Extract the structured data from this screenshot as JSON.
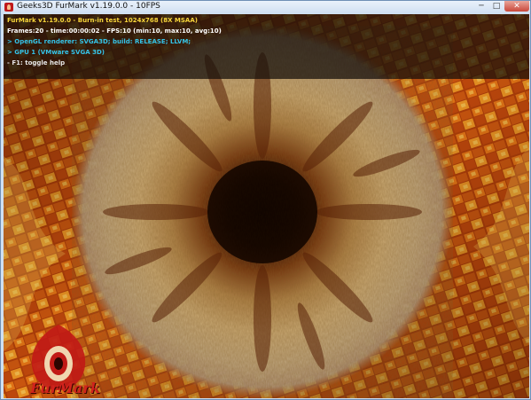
{
  "window": {
    "title": "Geeks3D FurMark v1.19.0.0 - 10FPS",
    "buttons": {
      "minimize": "─",
      "maximize": "□",
      "close": "✕"
    }
  },
  "hud": {
    "lines": [
      "FurMark v1.19.0.0 - Burn-in test, 1024x768 (8X MSAA)",
      "Frames:20 - time:00:00:02 - FPS:10 (min:10, max:10, avg:10)",
      "> OpenGL renderer: SVGA3D; build: RELEASE; LLVM;",
      "> GPU 1 (VMware SVGA 3D)",
      "- F1: toggle help"
    ],
    "colors": {
      "title": "#f6d53a",
      "stats": "#ffffff",
      "renderer": "#35c3e8",
      "help": "#e6e6e6"
    }
  },
  "logo": {
    "text": "FurMark",
    "icon": "furmark-logo-icon",
    "color": "#d1231d"
  },
  "scene": {
    "icon": "fur-donut-render"
  }
}
